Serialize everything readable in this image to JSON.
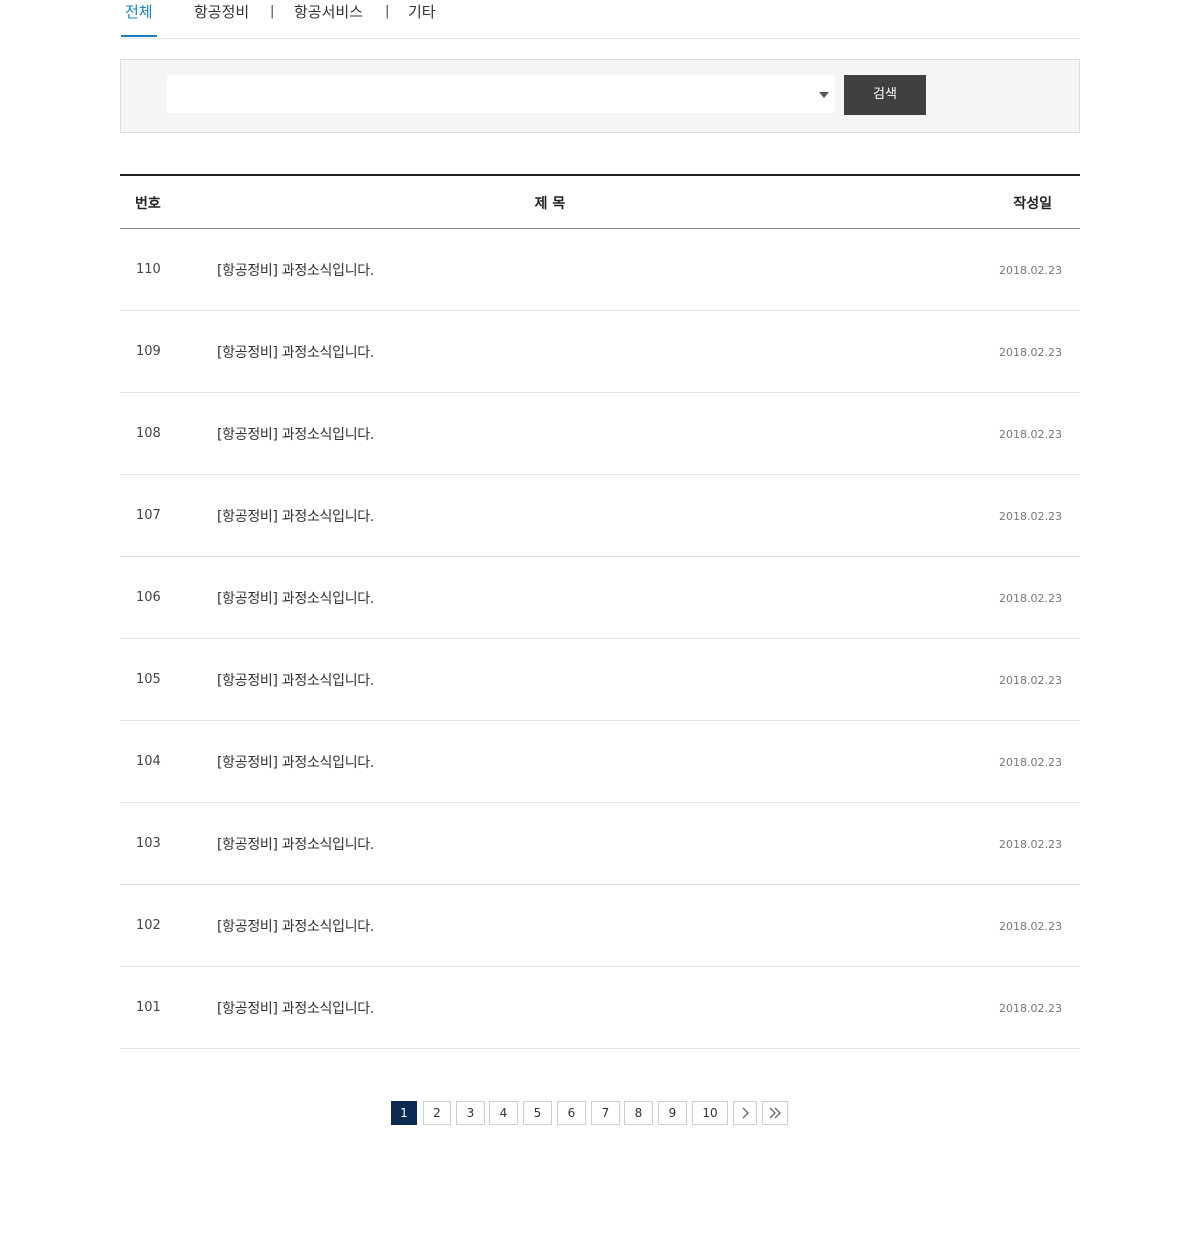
{
  "tabs": [
    {
      "label": "전체",
      "active": true
    },
    {
      "label": "항공정비",
      "active": false
    },
    {
      "label": "항공서비스",
      "active": false
    },
    {
      "label": "기타",
      "active": false
    }
  ],
  "tab_separator": "|",
  "search": {
    "select_value": "",
    "button_label": "검색"
  },
  "table": {
    "headers": {
      "no": "번호",
      "title": "제 목",
      "date": "작성일"
    },
    "rows": [
      {
        "no": "110",
        "title": "[항공정비] 과정소식입니다.",
        "date": "2018.02.23"
      },
      {
        "no": "109",
        "title": "[항공정비] 과정소식입니다.",
        "date": "2018.02.23"
      },
      {
        "no": "108",
        "title": "[항공정비] 과정소식입니다.",
        "date": "2018.02.23"
      },
      {
        "no": "107",
        "title": "[항공정비] 과정소식입니다.",
        "date": "2018.02.23"
      },
      {
        "no": "106",
        "title": "[항공정비] 과정소식입니다.",
        "date": "2018.02.23"
      },
      {
        "no": "105",
        "title": "[항공정비] 과정소식입니다.",
        "date": "2018.02.23"
      },
      {
        "no": "104",
        "title": "[항공정비] 과정소식입니다.",
        "date": "2018.02.23"
      },
      {
        "no": "103",
        "title": "[항공정비] 과정소식입니다.",
        "date": "2018.02.23"
      },
      {
        "no": "102",
        "title": "[항공정비] 과정소식입니다.",
        "date": "2018.02.23"
      },
      {
        "no": "101",
        "title": "[항공정비] 과정소식입니다.",
        "date": "2018.02.23"
      }
    ]
  },
  "pagination": {
    "pages": [
      "1",
      "2",
      "3",
      "4",
      "5",
      "6",
      "7",
      "8",
      "9",
      "10"
    ],
    "current": "1",
    "next_icon": "chevron-right-icon",
    "last_icon": "double-chevron-right-icon"
  },
  "colors": {
    "active_tab": "#1a7fc1",
    "search_button": "#404040",
    "current_page": "#0c2a52"
  }
}
